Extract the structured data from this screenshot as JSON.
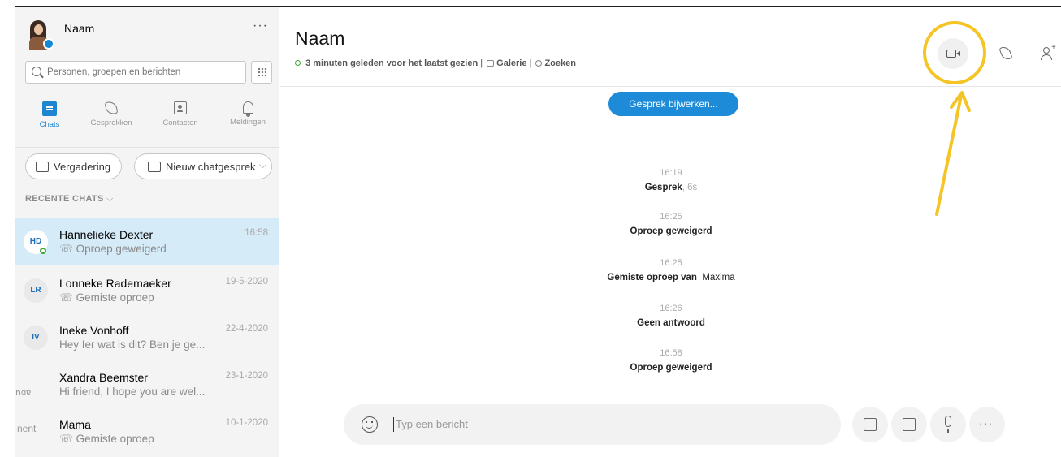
{
  "profile": {
    "name": "Naam",
    "more": "···"
  },
  "search": {
    "placeholder": "Personen, groepen en berichten"
  },
  "nav": [
    {
      "label": "Chats",
      "icon": "chat-icon",
      "active": true
    },
    {
      "label": "Gesprekken",
      "icon": "phone-icon",
      "active": false
    },
    {
      "label": "Contacten",
      "icon": "contacts-icon",
      "active": false
    },
    {
      "label": "Meldingen",
      "icon": "bell-icon",
      "active": false
    }
  ],
  "actions": {
    "meeting": "Vergadering",
    "new_chat": "Nieuw chatgesprek"
  },
  "recent_label": "RECENTE CHATS",
  "chats": [
    {
      "initials": "HD",
      "name": "Hannelieke Dexter",
      "sub": "Oproep geweigerd",
      "date": "16:58"
    },
    {
      "initials": "LR",
      "name": "Lonneke Rademaeker",
      "sub": "Gemiste oproep",
      "date": "19-5-2020"
    },
    {
      "initials": "IV",
      "name": "Ineke Vonhoff",
      "sub": "Hey Ier wat is dit? Ben je ge...",
      "date": "22-4-2020"
    },
    {
      "initials": "",
      "name": "Xandra Beemster",
      "sub": "Hi friend, I hope you are wel...",
      "date": "23-1-2020"
    },
    {
      "initials": "",
      "name": "Mama",
      "sub": "Gemiste oproep",
      "date": "10-1-2020"
    }
  ],
  "conversation": {
    "title": "Naam",
    "last_seen": "3 minuten geleden voor het laatst gezien",
    "gallery": "Galerie",
    "find": "Zoeken",
    "update_button": "Gesprek bijwerken...",
    "events": [
      {
        "time": "16:19",
        "text": "Gesprek",
        "extra": ", 6s"
      },
      {
        "time": "16:25",
        "text": "Oproep geweigerd",
        "extra": ""
      },
      {
        "time": "16:25",
        "text": "Gemiste oproep van",
        "extra": "Maxima"
      },
      {
        "time": "16:26",
        "text": "Geen antwoord",
        "extra": ""
      },
      {
        "time": "16:58",
        "text": "Oproep geweigerd",
        "extra": ""
      }
    ],
    "composer_placeholder": "Typ een bericht"
  },
  "colors": {
    "accent": "#1e8bd8",
    "highlight": "#f5c425",
    "selected_row": "#d6ebf8"
  }
}
